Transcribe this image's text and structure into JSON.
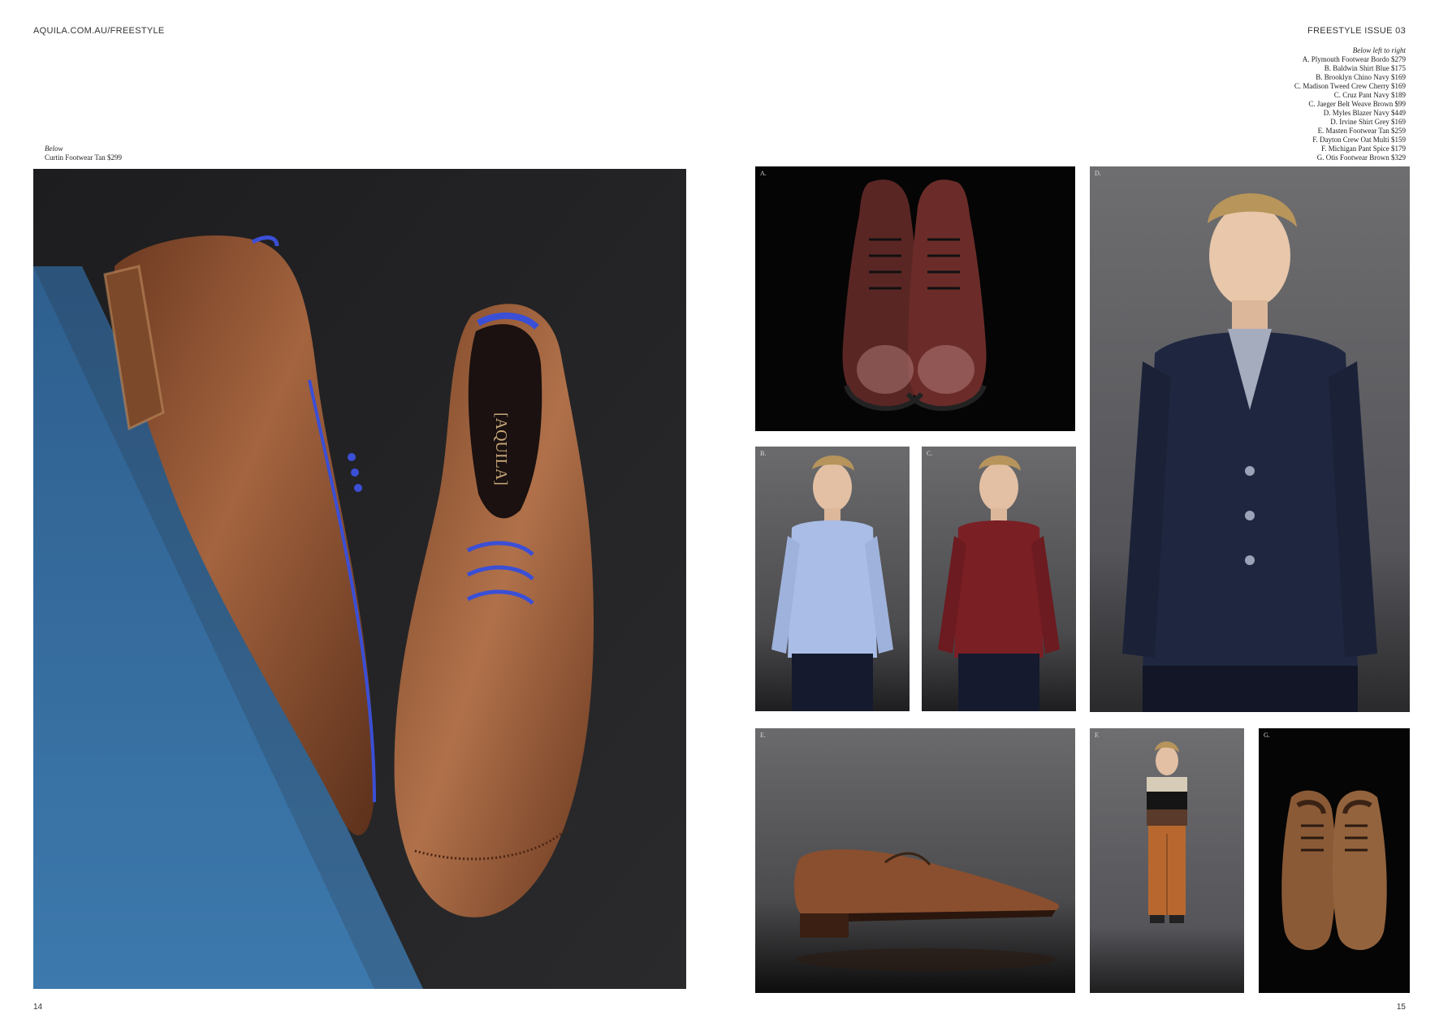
{
  "header": {
    "left_url": "AQUILA.COM.AU/FREESTYLE",
    "right_issue": "FREESTYLE ISSUE 03"
  },
  "left_page": {
    "caption_intro": "Below",
    "caption_item": "Curtin Footwear Tan $299",
    "insole_brand": "[AQUILA]",
    "page_number": "14"
  },
  "right_page": {
    "credits_intro": "Below left to right",
    "credits": [
      "A. Plymouth Footwear Bordo $279",
      "B. Baldwin Shirt Blue $175",
      "B. Brooklyn Chino Navy $169",
      "C. Madison Tweed Crew Cherry $169",
      "C. Cruz Pant Navy $189",
      "C. Jaeger Belt Weave Brown $99",
      "D. Myles Blazer Navy $449",
      "D. Irvine Shirt Grey $169",
      "E. Masten Footwear Tan $259",
      "F. Dayton Crew Oat Multi $159",
      "F. Michigan Pant Spice $179",
      "G. Otis Footwear Brown $329"
    ],
    "panel_labels": {
      "a": "A.",
      "b": "B.",
      "c": "C.",
      "d": "D.",
      "e": "E.",
      "f": "F.",
      "g": "G."
    },
    "page_number": "15"
  },
  "colors": {
    "leather_tan": "#8a4f2e",
    "leather_bordo": "#5a2624",
    "laces_blue": "#3b4fd6",
    "blazer_navy": "#1f2740",
    "shirt_blue": "#a9bde6",
    "crew_cherry": "#7a1f24",
    "pant_spice": "#b8682f"
  }
}
